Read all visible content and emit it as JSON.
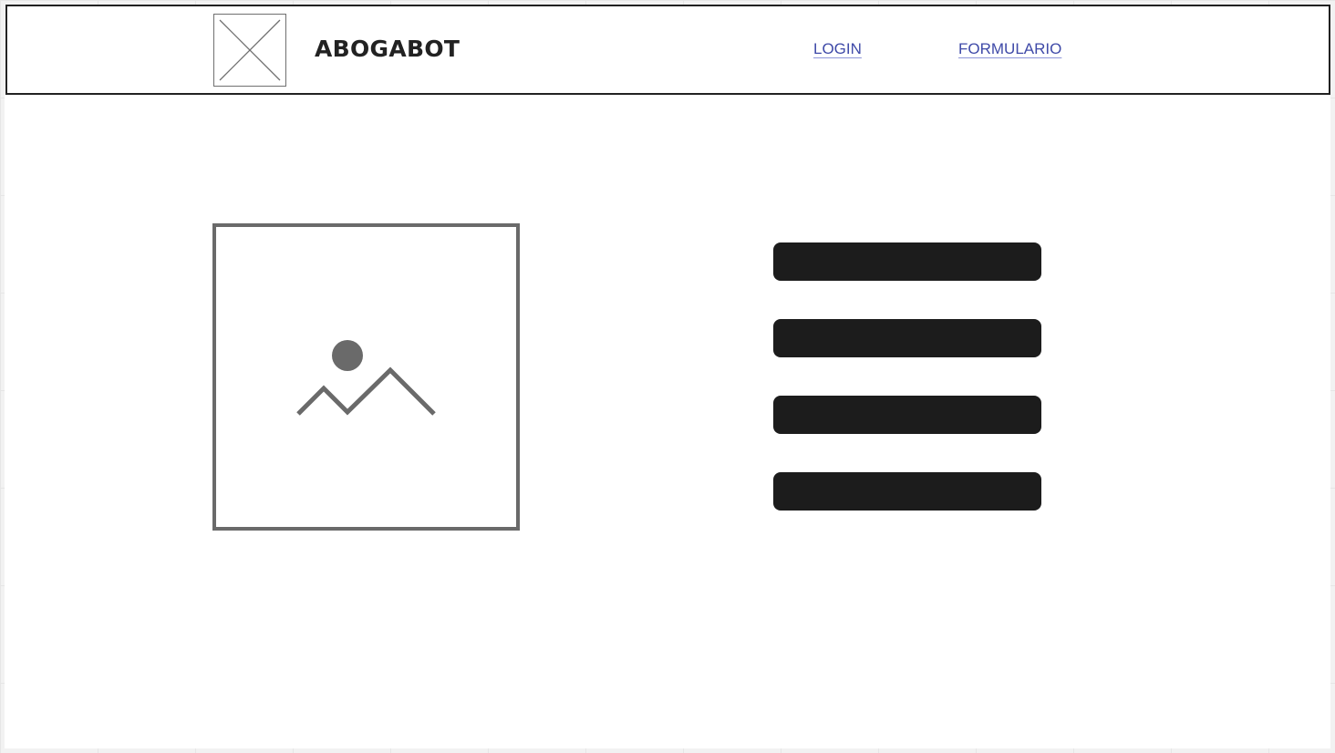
{
  "header": {
    "brand": "ABOGABOT",
    "nav": {
      "login_label": "LOGIN",
      "form_label": "FORMULARIO"
    }
  },
  "icons": {
    "logo": "logo-placeholder-icon",
    "hero_image": "image-placeholder-icon",
    "menu": "hamburger-menu-icon"
  },
  "colors": {
    "link": "#3f4aa8",
    "bar": "#1c1c1c",
    "placeholder_stroke": "#6a6a6a",
    "header_border": "#222222"
  }
}
